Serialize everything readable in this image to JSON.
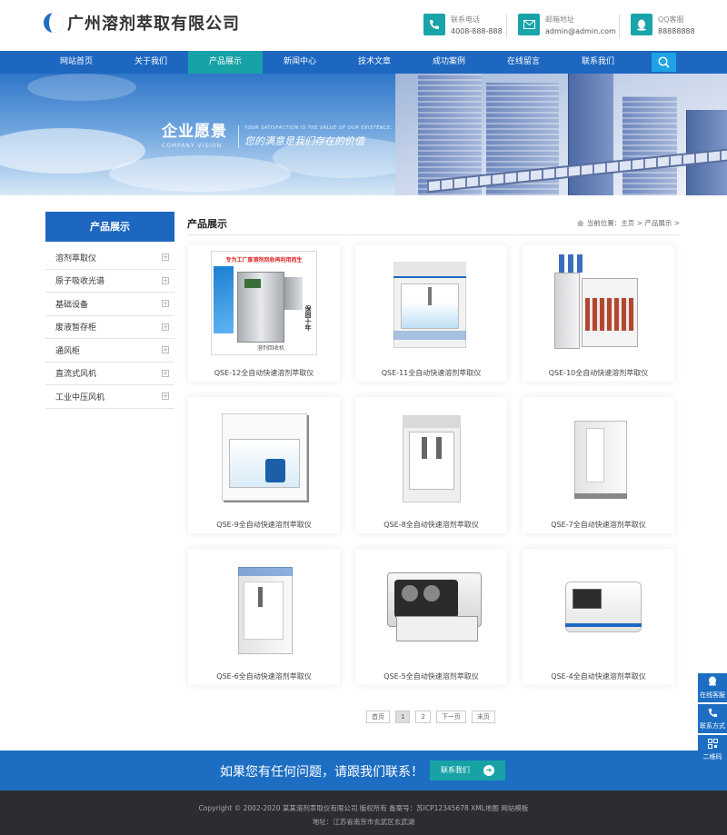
{
  "header": {
    "company": "广州溶剂萃取有限公司",
    "contacts": [
      {
        "icon": "phone-icon",
        "title": "联系电话",
        "value": "4008-888-888"
      },
      {
        "icon": "email-icon",
        "title": "邮箱地址",
        "value": "admin@admin.com"
      },
      {
        "icon": "qq-icon",
        "title": "QQ客服",
        "value": "88888888"
      }
    ]
  },
  "nav": {
    "items": [
      "网站首页",
      "关于我们",
      "产品展示",
      "新闻中心",
      "技术文章",
      "成功案例",
      "在线留言",
      "联系我们"
    ],
    "active_index": 2
  },
  "banner": {
    "title": "企业愿景",
    "title_en": "COMPANY VISION",
    "slogan_en": "YOUR SATISFACTION IS THE VALUE OF OUR EXISTENCE.",
    "slogan": "您的满意是我们存在的价值"
  },
  "sidebar": {
    "title": "产品展示",
    "items": [
      "溶剂萃取仪",
      "原子吸收光谱",
      "基础设备",
      "废液暂存柜",
      "通风柜",
      "直流式风机",
      "工业中压风机"
    ]
  },
  "content": {
    "title": "产品展示",
    "breadcrumb": "当前位置：主页 > 产品展示 >",
    "products": [
      {
        "name": "QSE-12全自动快速溶剂萃取仪",
        "banner_text": "专为工厂废溶剂回收再利用而生",
        "badge": "保固十年",
        "side_text": "溶剂回收机"
      },
      {
        "name": "QSE-11全自动快速溶剂萃取仪"
      },
      {
        "name": "QSE-10全自动快速溶剂萃取仪"
      },
      {
        "name": "QSE-9全自动快速溶剂萃取仪"
      },
      {
        "name": "QSE-8全自动快速溶剂萃取仪"
      },
      {
        "name": "QSE-7全自动快速溶剂萃取仪"
      },
      {
        "name": "QSE-6全自动快速溶剂萃取仪"
      },
      {
        "name": "QSE-5全自动快速溶剂萃取仪"
      },
      {
        "name": "QSE-4全自动快速溶剂萃取仪"
      }
    ]
  },
  "pager": {
    "first": "首页",
    "pages": [
      "1",
      "2"
    ],
    "current": "1",
    "next": "下一页",
    "last": "末页"
  },
  "cta": {
    "text": "如果您有任何问题，请跟我们联系！",
    "button": "联系我们"
  },
  "footer": {
    "line1": "Copyright © 2002-2020 某某溶剂萃取仪有限公司 版权所有 备案号：苏ICP12345678 XML地图 网站模板",
    "line2": "地址：江苏省南京市玄武区玄武湖"
  },
  "float_bar": {
    "online": "在线客服",
    "contact": "联系方式",
    "qrcode": "二维码"
  },
  "colors": {
    "primary": "#1d67c1",
    "accent": "#17a2a6",
    "footer": "#2b2d31"
  }
}
